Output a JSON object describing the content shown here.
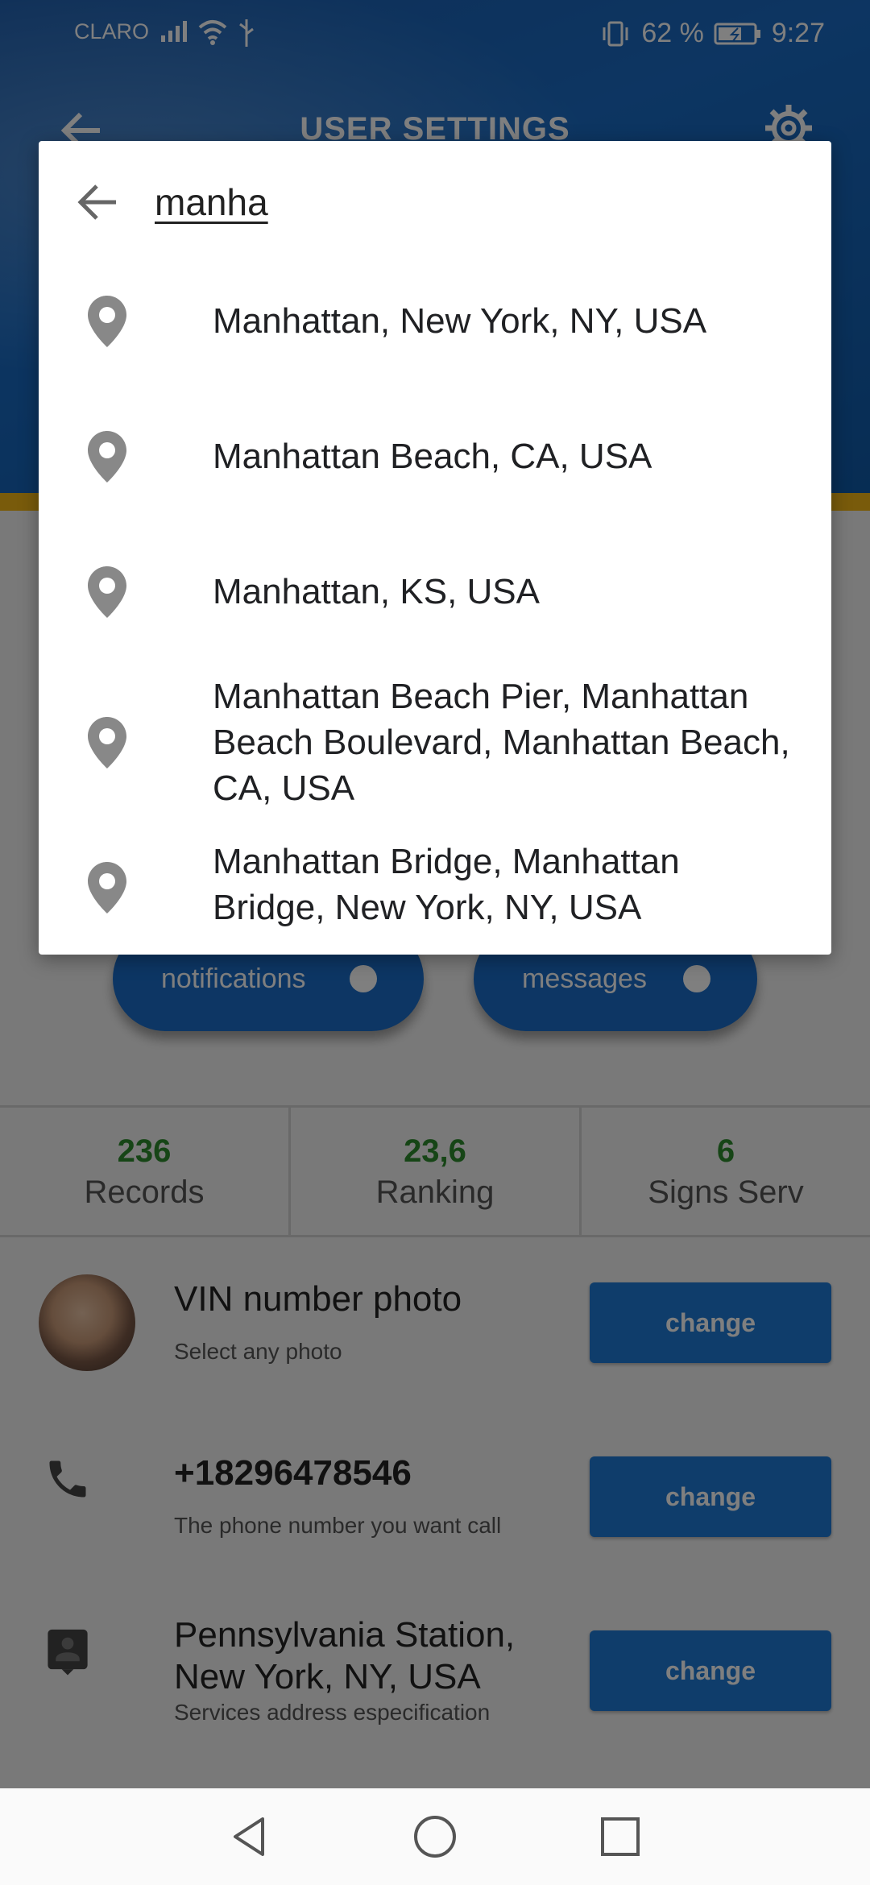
{
  "status_bar": {
    "carrier": "CLARO",
    "battery": "62 %",
    "time": "9:27"
  },
  "app_bar": {
    "title": "USER SETTINGS"
  },
  "search": {
    "query": "manha",
    "results": [
      "Manhattan, New York, NY, USA",
      "Manhattan Beach, CA, USA",
      "Manhattan, KS, USA",
      "Manhattan Beach Pier, Manhattan Beach Boulevard, Manhattan Beach, CA, USA",
      "Manhattan Bridge, Manhattan Bridge, New York, NY, USA"
    ]
  },
  "toggles": {
    "notifications_label": "notifications",
    "messages_label": "messages"
  },
  "stats": [
    {
      "value": "236",
      "label": "Records"
    },
    {
      "value": "23,6",
      "label": "Ranking"
    },
    {
      "value": "6",
      "label": "Signs Serv"
    }
  ],
  "settings": {
    "vin": {
      "title": "VIN number photo",
      "subtitle": "Select any photo",
      "button": "change"
    },
    "phone": {
      "title": "+18296478546",
      "subtitle": "The phone number you want call",
      "button": "change"
    },
    "address": {
      "title": "Pennsylvania Station, New York, NY, USA",
      "subtitle": "Services address especification",
      "button": "change"
    }
  },
  "colors": {
    "primary": "#1a6dc8",
    "accent_stripe": "#f2b617",
    "stat_value": "#2d8a2d",
    "button": "#1e7ad6"
  }
}
